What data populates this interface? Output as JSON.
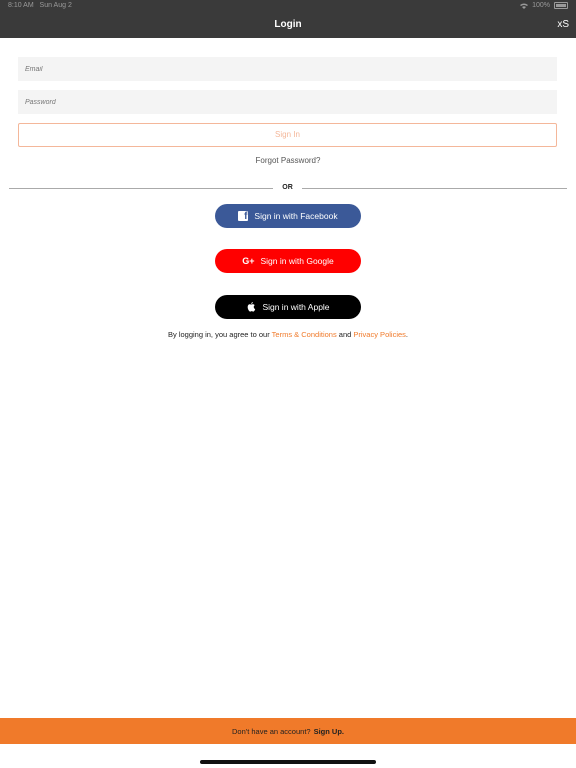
{
  "status": {
    "time": "8:10 AM",
    "date": "Sun Aug 2",
    "battery": "100%"
  },
  "nav": {
    "title": "Login",
    "right": "xS"
  },
  "form": {
    "email_placeholder": "Email",
    "password_placeholder": "Password",
    "sign_in": "Sign In",
    "forgot": "Forgot Password?",
    "or": "OR"
  },
  "social": {
    "facebook": "Sign in with Facebook",
    "google": "Sign in with Google",
    "apple": "Sign in with Apple"
  },
  "terms": {
    "prefix": "By logging in, you agree to our ",
    "terms_link": "Terms & Conditions",
    "and": " and ",
    "privacy_link": "Privacy Policies",
    "suffix": "."
  },
  "footer": {
    "prompt": "Don't have an account?",
    "signup": "Sign Up."
  },
  "colors": {
    "accent": "#f07a2a",
    "facebook": "#3b5998",
    "google": "#ff0000",
    "apple": "#000000",
    "nav": "#3a3a3a"
  },
  "icons": {
    "facebook": "facebook-icon",
    "google": "google-plus-icon",
    "apple": "apple-icon",
    "wifi": "wifi-icon",
    "battery": "battery-icon"
  }
}
